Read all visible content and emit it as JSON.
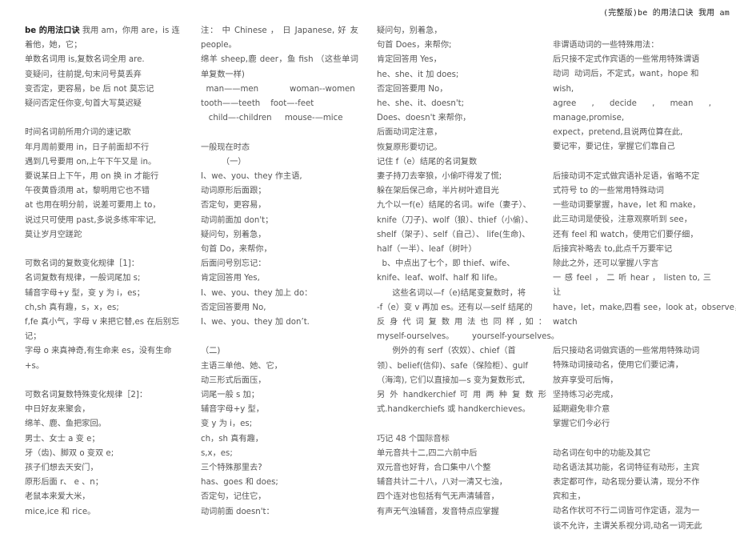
{
  "header": {
    "title": "(完整版)be 的用法口诀 我用 am"
  },
  "columns": [
    {
      "lines": [
        {
          "text": "be 的用法口诀 我用 am，你用 are，is 连",
          "bold_prefix": "be 的用法口诀"
        },
        {
          "text": "着他，她，它；"
        },
        {
          "text": "单数名词用 is,复数名词全用 are."
        },
        {
          "text": "变疑问，往前提,句末问号莫丢弃"
        },
        {
          "text": "变否定，更容易，be 后 not 莫忘记"
        },
        {
          "text": "疑问否定任你变,句首大写莫迟疑"
        },
        {
          "text": ""
        },
        {
          "text": "时间名词前所用介词的速记歌"
        },
        {
          "text": "年月周前要用 in，日子前面却不行"
        },
        {
          "text": "遇到几号要用 on,上午下午又是 in。"
        },
        {
          "text": "要说某日上下午，用 on 换 in 才能行"
        },
        {
          "text": "午夜黄昏须用 at，黎明用它也不错"
        },
        {
          "text": "at 也用在明分前，说差可要用上 to，"
        },
        {
          "text": "说过只可使用 past,多说多练牢牢记,"
        },
        {
          "text": "莫让岁月空蹉跎"
        },
        {
          "text": ""
        },
        {
          "text": "可数名词的复数变化规律［1]："
        },
        {
          "text": "名词复数有规律，一般词尾加 s;"
        },
        {
          "text": "辅音字母+y 型，变 y 为 i，es；"
        },
        {
          "text": "ch,sh 真有趣，s，x，es;"
        },
        {
          "text": "f,fe 真小气，字母 v 来把它替,es 在后别忘"
        },
        {
          "text": "记；"
        },
        {
          "text": "字母 o 来真神奇,有生命来 es，没有生命"
        },
        {
          "text": "+s。"
        },
        {
          "text": ""
        },
        {
          "text": "可数名词复数特殊变化规律［2]："
        },
        {
          "text": "中日好友来聚会，"
        },
        {
          "text": "绵羊、鹿、鱼把家回。"
        },
        {
          "text": "男士、女士 a 变 e；"
        },
        {
          "text": "牙（齿)、脚双 o 变双 e;"
        },
        {
          "text": "孩子们想去天安门，"
        },
        {
          "text": "原形后面 r、 e 、n；"
        },
        {
          "text": "老鼠本来爱大米，"
        },
        {
          "text": "mice,ice 和 rice。"
        }
      ]
    },
    {
      "lines": [
        {
          "text": "注： 中 Chinese ， 日 Japanese, 好 友",
          "justify": true
        },
        {
          "text": "people。"
        },
        {
          "text": "绵羊 sheep,鹿 deer，鱼 fish （这些单词",
          "justify": true
        },
        {
          "text": "单复数一样)"
        },
        {
          "text": "  man——men            woman--women"
        },
        {
          "text": "tooth——teeth    foot—-feet"
        },
        {
          "text": "   child—-children     mouse-—mice"
        },
        {
          "text": ""
        },
        {
          "text": "一般现在时态"
        },
        {
          "text": "        （一）"
        },
        {
          "text": "I、we、you、they 作主语,"
        },
        {
          "text": "动词原形后面跟；"
        },
        {
          "text": "否定句，更容易，"
        },
        {
          "text": "动词前面加 don't；"
        },
        {
          "text": "疑问句，别着急，"
        },
        {
          "text": "句首 Do，来帮你，"
        },
        {
          "text": "后面问号别忘记："
        },
        {
          "text": "肯定回答用 Yes,"
        },
        {
          "text": "I、we、you、they 加上 do："
        },
        {
          "text": "否定回答要用 No,"
        },
        {
          "text": "I、we、you、they 加 don’t."
        },
        {
          "text": ""
        },
        {
          "text": "（二)"
        },
        {
          "text": "主语三单他、她、它，"
        },
        {
          "text": "动三形式后面压，"
        },
        {
          "text": "词尾一般 s 加；"
        },
        {
          "text": "辅音字母+y 型，"
        },
        {
          "text": "变 y 为 i，es;"
        },
        {
          "text": "ch，sh 真有趣，"
        },
        {
          "text": "s,x，es;"
        },
        {
          "text": "三个特殊那里去?"
        },
        {
          "text": "has、goes 和 does;"
        },
        {
          "text": "否定句，记住它，"
        },
        {
          "text": "动词前面 doesn't："
        }
      ]
    },
    {
      "lines": [
        {
          "text": "疑问句，别着急，"
        },
        {
          "text": "句首 Does，来帮你;"
        },
        {
          "text": "肯定回答用 Yes，"
        },
        {
          "text": "he、she、it 加 does;"
        },
        {
          "text": "否定回答要用 No，"
        },
        {
          "text": "he、she、it、doesn't;"
        },
        {
          "text": "Does、doesn't 来帮你，"
        },
        {
          "text": "后面动词定注意，"
        },
        {
          "text": "恢复原形要切记。"
        },
        {
          "text": "记住 f（e）结尾的名词复数"
        },
        {
          "text": "妻子持刀去宰狼，小偷吓得发了慌;"
        },
        {
          "text": "躲在架后保己命，半片树叶遮目光"
        },
        {
          "text": "九个以一f(e）结尾的名词。wife（妻子）、"
        },
        {
          "text": "knife（刀子)、wolf（狼）、thief（小偷）、"
        },
        {
          "text": "shelf（架子）、self（自己）、 life(生命)、"
        },
        {
          "text": "half（一半）、leaf（树叶）"
        },
        {
          "text": "  b、中点出了七个，即 thief、wife、"
        },
        {
          "text": "knife、leaf、wolf、half 和 life。"
        },
        {
          "text": "      这些名词以—f（e)结尾变复数时，将"
        },
        {
          "text": "-f（e）变 v 再加 es。还有以—self 结尾的"
        },
        {
          "text": "反 身 代 词 复 数 用 法 也 同 样 , 如 ：",
          "justify": true
        },
        {
          "text": "myself-ourselves。       yourself-yourselves。"
        },
        {
          "text": "      例外的有 serf（农奴）、chief（首"
        },
        {
          "text": "领）、belief(信仰)、safe（保险柜）、gulf"
        },
        {
          "text": "（海湾), 它们以直接加—s 变为复数形式,"
        },
        {
          "text": "另 外 handkerchief 可 用 两 种 复 数 形",
          "justify": true
        },
        {
          "text": "式.handkerchiefs 或 handkerchieves。"
        },
        {
          "text": ""
        },
        {
          "text": "巧记 48 个国际音标"
        },
        {
          "text": "单元音共十二,四二六前中后"
        },
        {
          "text": "双元音也好背，合口集中八个整"
        },
        {
          "text": "辅音共计二十八，八对一清又七浊，"
        },
        {
          "text": "四个连对也包括有气无声清辅音，"
        },
        {
          "text": "有声无气浊辅音，发音特点应掌握"
        }
      ]
    },
    {
      "lines": [
        {
          "text": "非谓语动词的一些特殊用法："
        },
        {
          "text": "后只接不定式作宾语的一些常用特殊谓语"
        },
        {
          "text": "动词  动词后，不定式，want，hope 和"
        },
        {
          "text": "wish,"
        },
        {
          "text": "agree    ,    decide    ,    mean    ,",
          "justify": true
        },
        {
          "text": "manage,promise,"
        },
        {
          "text": "expect，pretend,且说两位算在此,"
        },
        {
          "text": "要记牢，要记住，掌握它们靠自己"
        },
        {
          "text": ""
        },
        {
          "text": "后接动词不定式做宾语补足语，省略不定"
        },
        {
          "text": "式符号 to 的一些常用特殊动词"
        },
        {
          "text": "一些动词要掌握，have，let 和 make，"
        },
        {
          "text": "此三动词是使役，注意观察听到 see，"
        },
        {
          "text": "还有 feel 和 watch，使用它们要仔细，"
        },
        {
          "text": "后接宾补略去 to,此点千万要牢记"
        },
        {
          "text": "除此之外，还可以掌握八字言"
        },
        {
          "text": "一 感  feel ， 二 听  hear ， listen  to, 三 让",
          "justify": true
        },
        {
          "text": "have，let，make,四看 see，look at，observe，"
        },
        {
          "text": "watch"
        },
        {
          "text": ""
        },
        {
          "text": "后只接动名词做宾语的一些常用特殊动词"
        },
        {
          "text": "特殊动词接动名，使用它们要记清，"
        },
        {
          "text": "放弃享受可后悔，"
        },
        {
          "text": "坚持练习必完成，"
        },
        {
          "text": "延期避免非介意"
        },
        {
          "text": "掌握它们今必行"
        },
        {
          "text": ""
        },
        {
          "text": "动名词在句中的功能及其它"
        },
        {
          "text": "动名语法其功能，名词特征有动形，主宾"
        },
        {
          "text": "表定都可作，动名现分要认清，现分不作"
        },
        {
          "text": "宾和主，"
        },
        {
          "text": "动名作状可不行二词皆可作定语，混为一"
        },
        {
          "text": "谈不允许，主谓关系视分词,动名一词无此"
        }
      ]
    }
  ]
}
